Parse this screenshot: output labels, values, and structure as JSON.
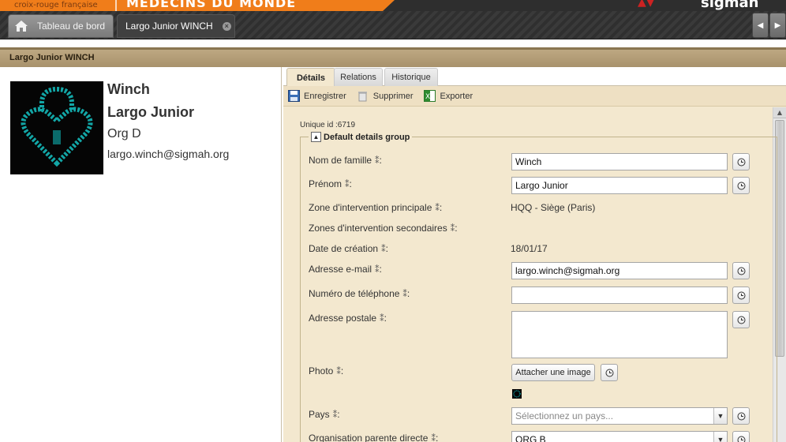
{
  "banner": {
    "org_left": "croix-rouge française",
    "org_main": "MÉDECINS DU MONDE",
    "app_logo": "sigmah"
  },
  "tabs": {
    "home_label": "Tableau de bord",
    "active_label": "Largo Junior WINCH"
  },
  "page": {
    "title": "Largo Junior WINCH"
  },
  "profile": {
    "last_name": "Winch",
    "first_name": "Largo Junior",
    "org": "Org D",
    "email": "largo.winch@sigmah.org"
  },
  "subtabs": [
    "Détails",
    "Relations",
    "Historique"
  ],
  "toolbar": {
    "save_label": "Enregistrer",
    "delete_label": "Supprimer",
    "export_label": "Exporter"
  },
  "details": {
    "unique_id": "Unique id :6719",
    "group_title": "Default details group",
    "fields": {
      "last_name": {
        "label": "Nom de famille",
        "value": "Winch"
      },
      "first_name": {
        "label": "Prénom",
        "value": "Largo Junior"
      },
      "main_zone": {
        "label": "Zone d'intervention principale",
        "value": "HQQ - Siège (Paris)"
      },
      "secondary_zones": {
        "label": "Zones d'intervention secondaires",
        "value": ""
      },
      "creation_date": {
        "label": "Date de création",
        "value": "18/01/17"
      },
      "email": {
        "label": "Adresse e-mail",
        "value": "largo.winch@sigmah.org"
      },
      "phone": {
        "label": "Numéro de téléphone",
        "value": ""
      },
      "postal": {
        "label": "Adresse postale",
        "value": ""
      },
      "photo": {
        "label": "Photo",
        "button": "Attacher une image"
      },
      "country": {
        "label": "Pays",
        "placeholder": "Sélectionnez un pays..."
      },
      "parent_org": {
        "label": "Organisation parente directe",
        "value": "ORG B"
      }
    }
  },
  "colors": {
    "accent_orange": "#f07d1a",
    "header_tan": "#bda882",
    "panel_bg": "#f3e8cf",
    "avatar_cyan": "#12a6a6"
  }
}
